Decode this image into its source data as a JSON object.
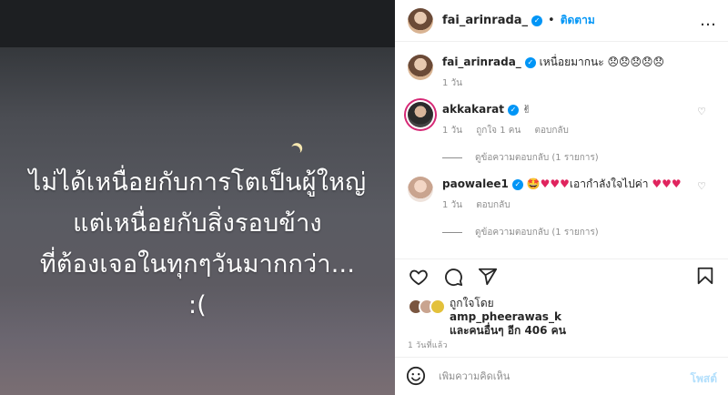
{
  "photo": {
    "caption_lines": [
      "ไม่ได้เหนื่อยกับการโตเป็นผู้ใหญ่",
      "แต่เหนื่อยกับสิ่งรอบข้าง",
      "ที่ต้องเจอในทุกๆวันมากกว่า...",
      ":("
    ]
  },
  "header": {
    "username": "fai_arinrada_",
    "separator": "•",
    "follow_label": "ติดตาม",
    "more_label": "…"
  },
  "comments": [
    {
      "username": "fai_arinrada_",
      "text": "เหนื่อยมากนะ 😞😞😞😞😞",
      "time": "1 วัน"
    },
    {
      "username": "akkakarat",
      "text": "✌",
      "time": "1 วัน",
      "likes": "ถูกใจ 1 คน",
      "reply_label": "ตอบกลับ",
      "view_replies": "ดูข้อความตอบกลับ (1 รายการ)"
    },
    {
      "username": "paowalee1",
      "text_prefix": "🤩♥♥♥",
      "text_mid": "เอากำลังใจไปค่า",
      "text_suffix": "♥♥♥",
      "time": "1 วัน",
      "reply_label": "ตอบกลับ",
      "view_replies": "ดูข้อความตอบกลับ (1 รายการ)"
    }
  ],
  "likes": {
    "prefix": "ถูกใจโดย",
    "user": "amp_pheerawas_k",
    "others": "และคนอื่นๆ อีก 406 คน"
  },
  "timeago": "1 วันที่แล้ว",
  "composer": {
    "placeholder": "เพิ่มความคิดเห็น",
    "post_label": "โพสต์"
  },
  "colors": {
    "accent": "#0095f6",
    "heart": "#e0245e",
    "muted": "#8e8e8e"
  },
  "icons": [
    "heart-icon",
    "comment-icon",
    "share-icon",
    "save-icon",
    "emoji-icon",
    "verified-icon"
  ]
}
